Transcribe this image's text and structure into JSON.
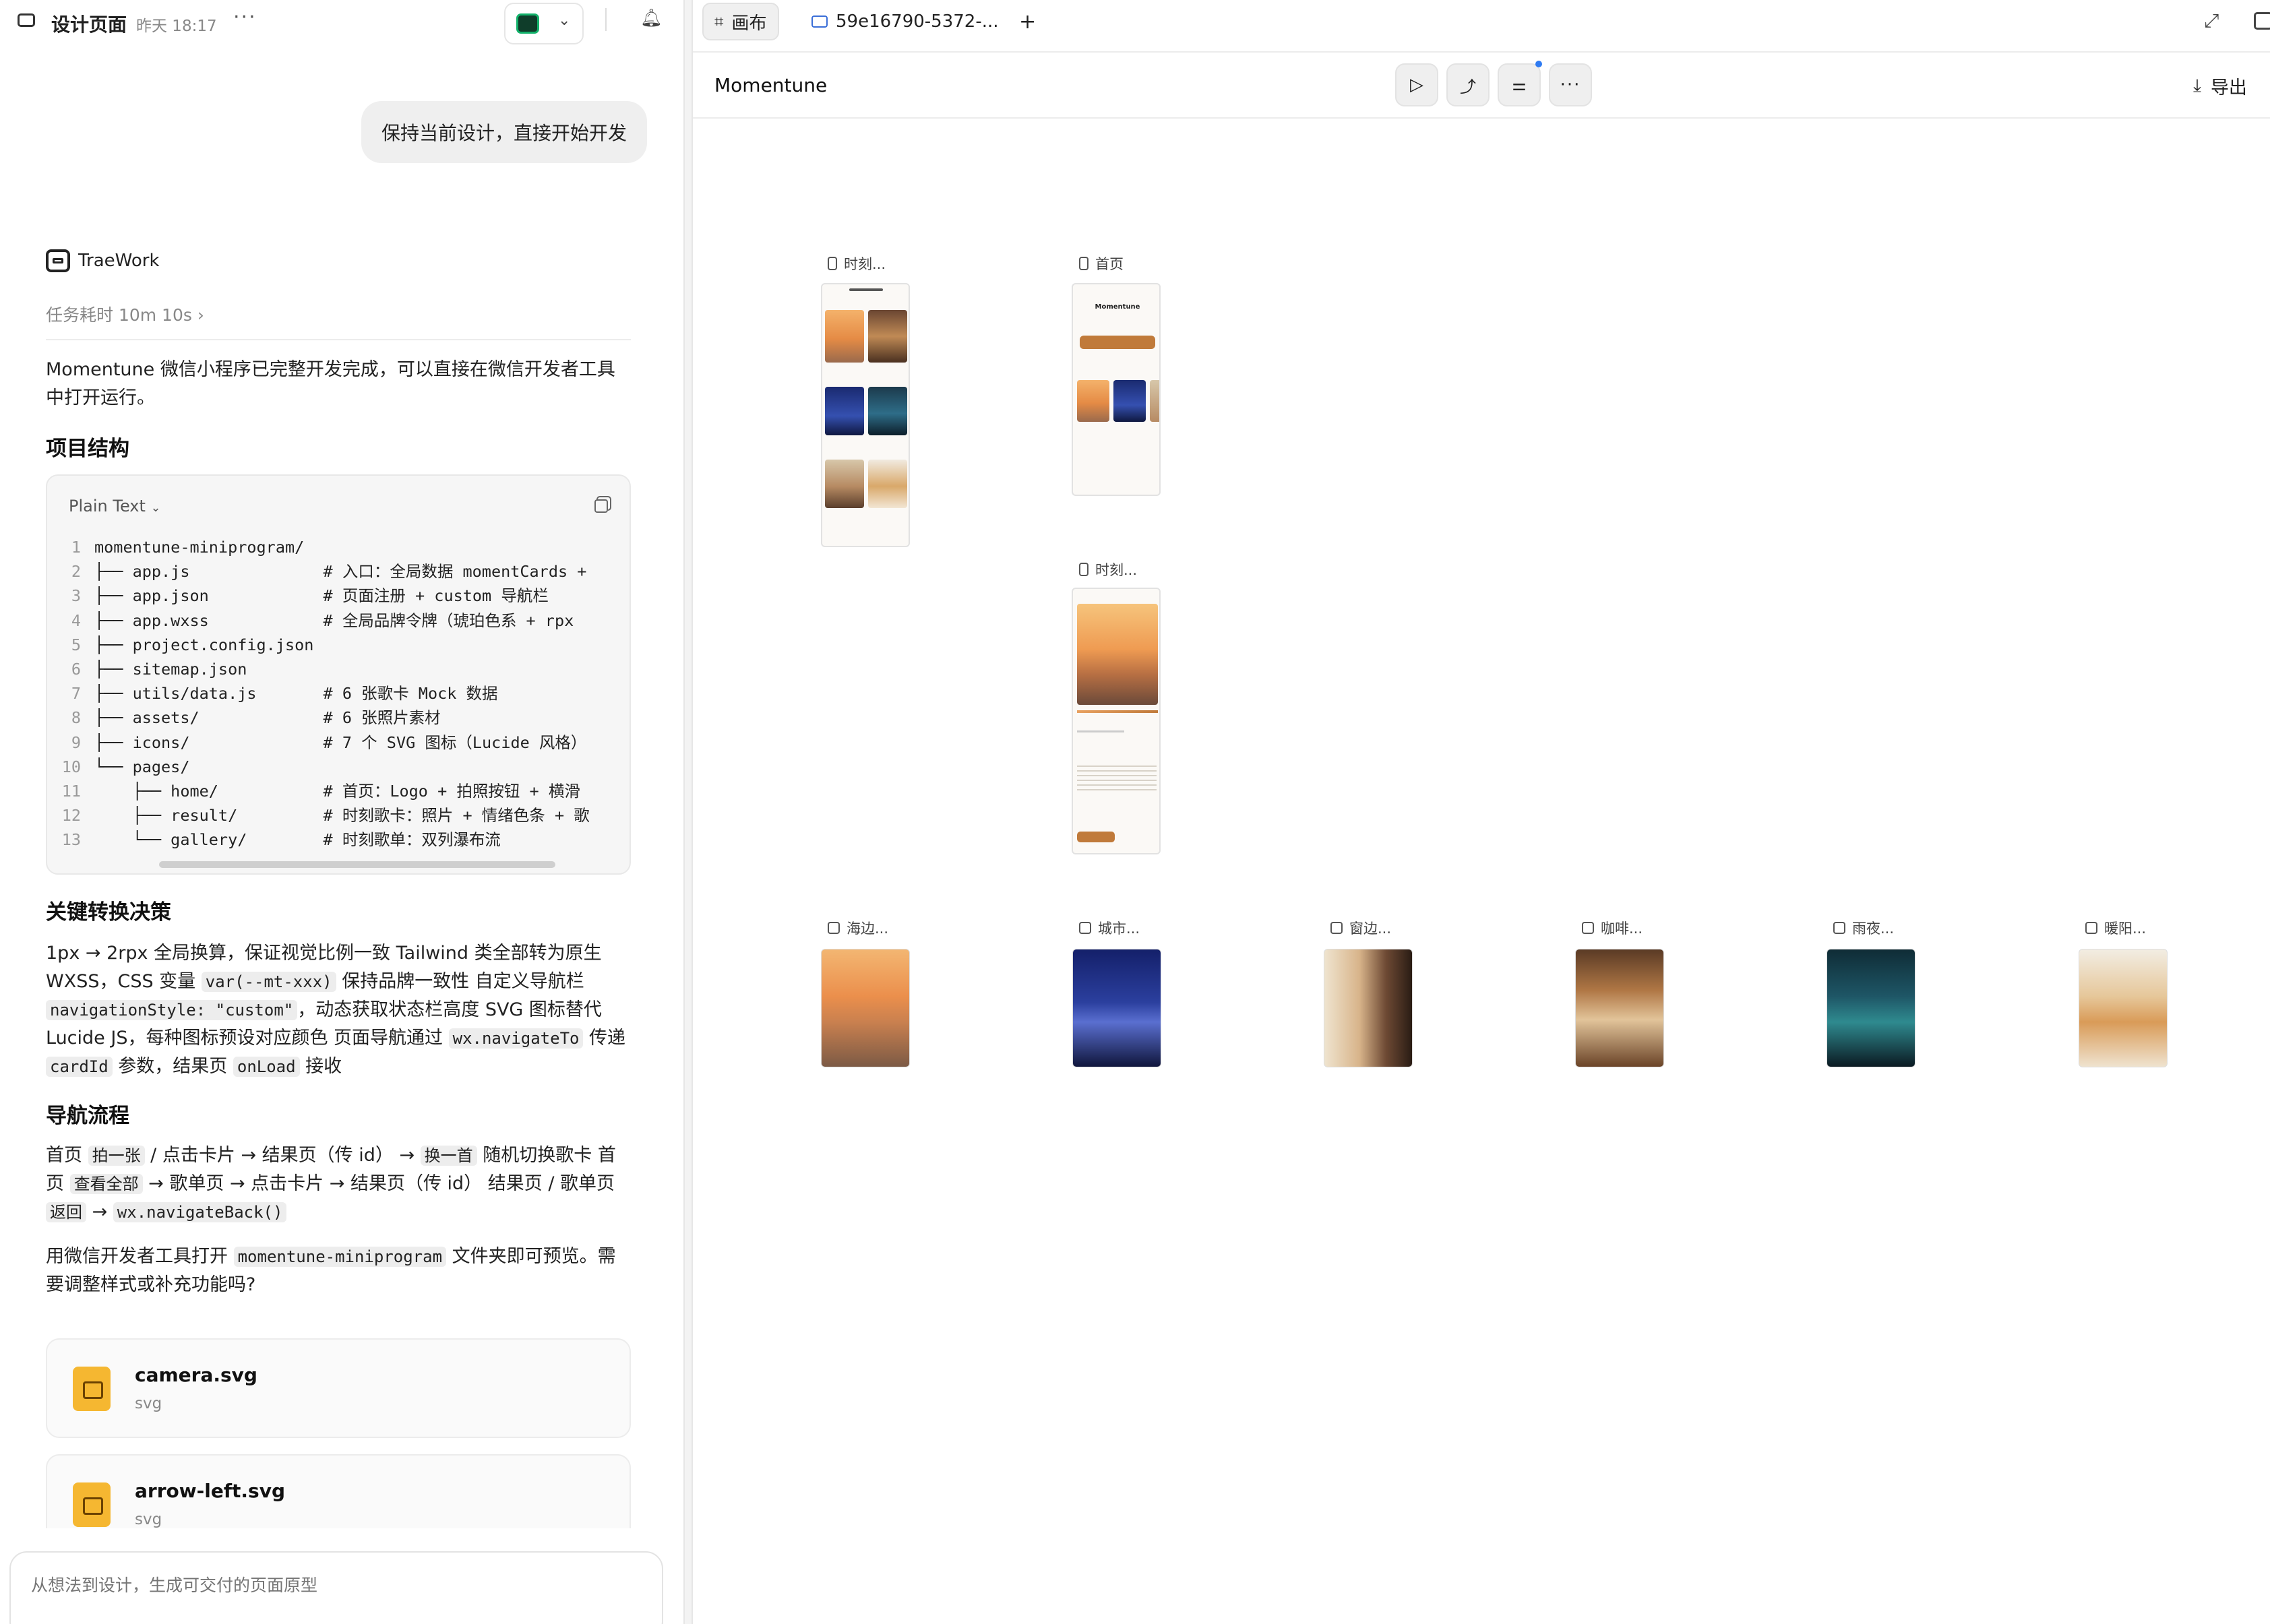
{
  "left": {
    "title": "设计页面",
    "time": "昨天 18:17",
    "user_message": "保持当前设计，直接开始开发",
    "agent_name": "TraeWork",
    "task_time": "任务耗时 10m 10s",
    "intro": "Momentune 微信小程序已完整开发完成，可以直接在微信开发者工具中打开运行。",
    "section1": "项目结构",
    "code_lang": "Plain Text",
    "code_lines": [
      {
        "n": "1",
        "t": "momentune-miniprogram/"
      },
      {
        "n": "2",
        "t": "├── app.js              # 入口：全局数据 momentCards + "
      },
      {
        "n": "3",
        "t": "├── app.json            # 页面注册 + custom 导航栏"
      },
      {
        "n": "4",
        "t": "├── app.wxss            # 全局品牌令牌（琥珀色系 + rpx"
      },
      {
        "n": "5",
        "t": "├── project.config.json"
      },
      {
        "n": "6",
        "t": "├── sitemap.json"
      },
      {
        "n": "7",
        "t": "├── utils/data.js       # 6 张歌卡 Mock 数据"
      },
      {
        "n": "8",
        "t": "├── assets/             # 6 张照片素材"
      },
      {
        "n": "9",
        "t": "├── icons/              # 7 个 SVG 图标（Lucide 风格）"
      },
      {
        "n": "10",
        "t": "└── pages/"
      },
      {
        "n": "11",
        "t": "    ├── home/           # 首页：Logo + 拍照按钮 + 横滑"
      },
      {
        "n": "12",
        "t": "    ├── result/         # 时刻歌卡：照片 + 情绪色条 + 歌"
      },
      {
        "n": "13",
        "t": "    └── gallery/        # 时刻歌单：双列瀑布流"
      }
    ],
    "section2": "关键转换决策",
    "s2_a": "1px → 2rpx 全局换算，保证视觉比例一致 Tailwind 类全部转为原生 WXSS，CSS 变量 ",
    "s2_code1": "var(--mt-xxx)",
    "s2_b": " 保持品牌一致性 自定义导航栏 ",
    "s2_code2": "navigationStyle: \"custom\"",
    "s2_c": "，动态获取状态栏高度 SVG 图标替代 Lucide JS，每种图标预设对应颜色 页面导航通过 ",
    "s2_code3": "wx.navigateTo",
    "s2_d": " 传递 ",
    "s2_code4": "cardId",
    "s2_e": " 参数，结果页 ",
    "s2_code5": "onLoad",
    "s2_f": " 接收",
    "section3": "导航流程",
    "s3_a": "首页 ",
    "s3_code1": "拍一张",
    "s3_b": " / 点击卡片 → 结果页（传 id） → ",
    "s3_code2": "换一首",
    "s3_c": " 随机切换歌卡 首页 ",
    "s3_code3": "查看全部",
    "s3_d": " → 歌单页 → 点击卡片 → 结果页（传 id） 结果页 / 歌单页 ",
    "s3_code4": "返回",
    "s3_e": " → ",
    "s3_code5": "wx.navigateBack()",
    "s4_a": "用微信开发者工具打开 ",
    "s4_code": "momentune-miniprogram",
    "s4_b": " 文件夹即可预览。需要调整样式或补充功能吗?",
    "files": [
      {
        "name": "camera.svg",
        "type": "svg"
      },
      {
        "name": "arrow-left.svg",
        "type": "svg"
      }
    ],
    "composer_placeholder": "从想法到设计，生成可交付的页面原型"
  },
  "right": {
    "tab_canvas": "画布",
    "tab_file": "59e16790-5372-...",
    "tab_add": "+",
    "project_name": "Momentune",
    "export_label": "导出",
    "frames": {
      "gallery_label": "时刻...",
      "home_label": "首页",
      "result_label": "时刻...",
      "home_logo": "Momentune"
    },
    "images": [
      {
        "label": "海边..."
      },
      {
        "label": "城市..."
      },
      {
        "label": "窗边..."
      },
      {
        "label": "咖啡..."
      },
      {
        "label": "雨夜..."
      },
      {
        "label": "暖阳..."
      }
    ]
  },
  "colors": {
    "accent": "#c07a3a",
    "sunset": "#e79a55",
    "night": "#1b2a6b"
  }
}
